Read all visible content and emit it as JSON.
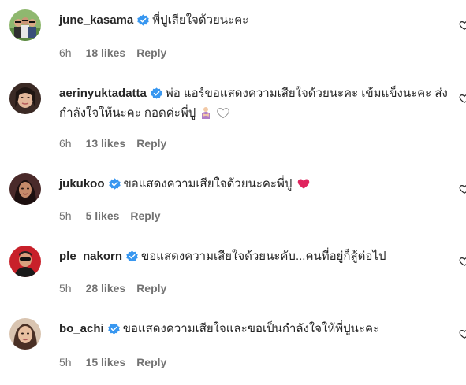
{
  "comments": [
    {
      "username": "june_kasama",
      "text": "พี่ปูเสียใจด้วยนะคะ",
      "time": "6h",
      "likes": "18 likes",
      "reply": "Reply"
    },
    {
      "username": "aerinyuktadatta",
      "text": "พ่อ แอร์ขอแสดงความเสียใจด้วยนะคะ เข้มแข็งนะคะ ส่งกำลังใจให้นะคะ กอดค่ะพี่ปู",
      "time": "6h",
      "likes": "13 likes",
      "reply": "Reply"
    },
    {
      "username": "jukukoo",
      "text": "ขอแสดงความเสียใจด้วยนะคะพี่ปู",
      "time": "5h",
      "likes": "5 likes",
      "reply": "Reply"
    },
    {
      "username": "ple_nakorn",
      "text": "ขอแสดงความเสียใจด้วยนะคับ...คนที่อยู่ก็สู้ต่อไป",
      "time": "5h",
      "likes": "28 likes",
      "reply": "Reply"
    },
    {
      "username": "bo_achi",
      "text": "ขอแสดงความเสียใจและขอเป็นกำลังใจให้พี่ปูนะคะ",
      "time": "5h",
      "likes": "15 likes",
      "reply": "Reply"
    }
  ],
  "colors": {
    "verified": "#3897f0",
    "meta": "#737373",
    "heart_red": "#ed4956"
  },
  "icons": {
    "verified": "verified-badge-icon",
    "like": "heart-outline-icon"
  }
}
